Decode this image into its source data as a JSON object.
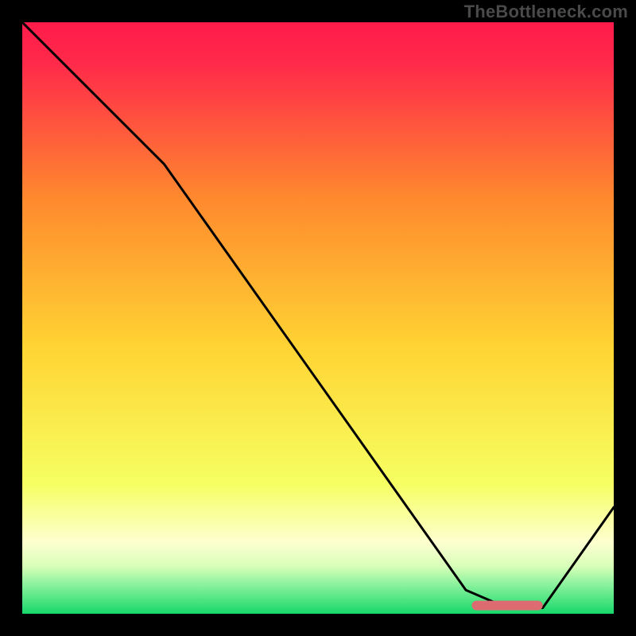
{
  "watermark": "TheBottleneck.com",
  "chart_data": {
    "type": "line",
    "title": "",
    "xlabel": "",
    "ylabel": "",
    "xlim": [
      0,
      100
    ],
    "ylim": [
      0,
      100
    ],
    "grid": false,
    "legend": false,
    "annotations": [],
    "background_gradient": [
      "#ff1b4b",
      "#ff9a2e",
      "#ffe63a",
      "#f8ff8a",
      "#1bdc6b"
    ],
    "series": [
      {
        "name": "bottleneck-curve",
        "stroke": "#000000",
        "x": [
          0,
          24,
          75,
          82,
          88,
          100
        ],
        "y": [
          100,
          76,
          4,
          1,
          1,
          18
        ]
      }
    ],
    "marker": {
      "name": "optimal-range",
      "shape": "rounded-bar",
      "x_start": 76,
      "x_end": 88,
      "y": 1.4,
      "color": "#dc6b72"
    }
  }
}
